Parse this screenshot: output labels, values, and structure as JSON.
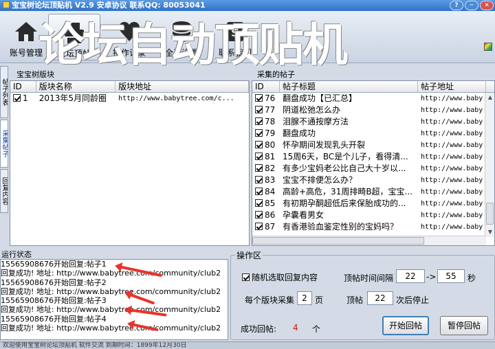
{
  "window": {
    "title": "宝宝树论坛顶贴机 V2.9 安卓协议 联系QQ: 80053041",
    "buttons": [
      "?",
      "─",
      "✕"
    ]
  },
  "banner": "论坛自动顶贴机",
  "toolbar": {
    "items": [
      {
        "label": "账号管理",
        "icon": "house-icon"
      },
      {
        "label": "论坛顶帖",
        "icon": "post-icon"
      },
      {
        "label": "操作记录",
        "icon": "heart-icon"
      },
      {
        "label": "全局设置",
        "icon": "database-icon"
      },
      {
        "label": "联系我们",
        "icon": "money-icon"
      }
    ]
  },
  "side_tabs": [
    "帖子列表",
    "采集帖子",
    "回复内容"
  ],
  "forum_panel": {
    "title": "宝宝树版块",
    "columns": [
      "ID",
      "版块名称",
      "版块地址"
    ],
    "rows": [
      {
        "id": "1",
        "name": "2013年5月同龄圈",
        "url": "http://www.babytree.com/c..."
      }
    ]
  },
  "post_panel": {
    "title": "采集的帖子",
    "columns": [
      "ID",
      "帖子标题",
      "帖子地址"
    ],
    "rows": [
      {
        "id": "76",
        "title": "翻盘成功【已汇总】",
        "url": "http://www.baby"
      },
      {
        "id": "77",
        "title": "阴道松弛怎么办",
        "url": "http://www.baby"
      },
      {
        "id": "78",
        "title": "泪腺不通按摩方法",
        "url": "http://www.baby"
      },
      {
        "id": "79",
        "title": "翻盘成功",
        "url": "http://www.baby"
      },
      {
        "id": "80",
        "title": "怀孕期间发现乳头开裂",
        "url": "http://www.baby"
      },
      {
        "id": "81",
        "title": "15周6天，BC是个儿子，看得清...",
        "url": "http://www.baby"
      },
      {
        "id": "82",
        "title": "有多少宝妈老公比自己大十岁以...",
        "url": "http://www.baby"
      },
      {
        "id": "83",
        "title": "宝宝不排便怎么办？",
        "url": "http://www.baby"
      },
      {
        "id": "84",
        "title": "高龄+高危，31周排畸B超，宝宝...",
        "url": "http://www.baby"
      },
      {
        "id": "85",
        "title": "有初期孕酮超低后来保胎成功的...",
        "url": "http://www.baby"
      },
      {
        "id": "86",
        "title": "孕囊看男女",
        "url": "http://www.baby"
      },
      {
        "id": "87",
        "title": "有香港验血鉴定性别的宝妈吗？",
        "url": "http://www.baby"
      }
    ]
  },
  "status": {
    "title": "运行状态",
    "lines": [
      "15565908676开始回复:帖子1",
      "回复成功! 地址: http://www.babytree.com/community/club2",
      "15565908676开始回复:帖子2",
      "回复成功! 地址: http://www.babytree.com/community/club2",
      "15565908676开始回复:帖子3",
      "回复成功! 地址: http://www.babytree.com/community/club2",
      "15565908676开始回复:帖子4",
      "回复成功! 地址: http://www.babytree.com/community/club2"
    ]
  },
  "ops": {
    "title": "操作区",
    "random_reply_label": "随机选取回复内容",
    "interval_label": "顶帖时间间隔",
    "interval_from": "22",
    "interval_sep": "->",
    "interval_to": "55",
    "interval_unit": "秒",
    "collect_label": "每个版块采集",
    "collect_value": "2",
    "collect_unit": "页",
    "stop_label": "顶帖",
    "stop_value": "22",
    "stop_unit": "次后停止",
    "success_label": "成功回帖:",
    "success_count": "4",
    "success_unit": "个",
    "start_button": "开始回帖",
    "pause_button": "暂停回帖"
  },
  "statusbar": "欢迎使用宝宝树论坛顶贴机    软件交流                              到期时间：1899年12月30日"
}
